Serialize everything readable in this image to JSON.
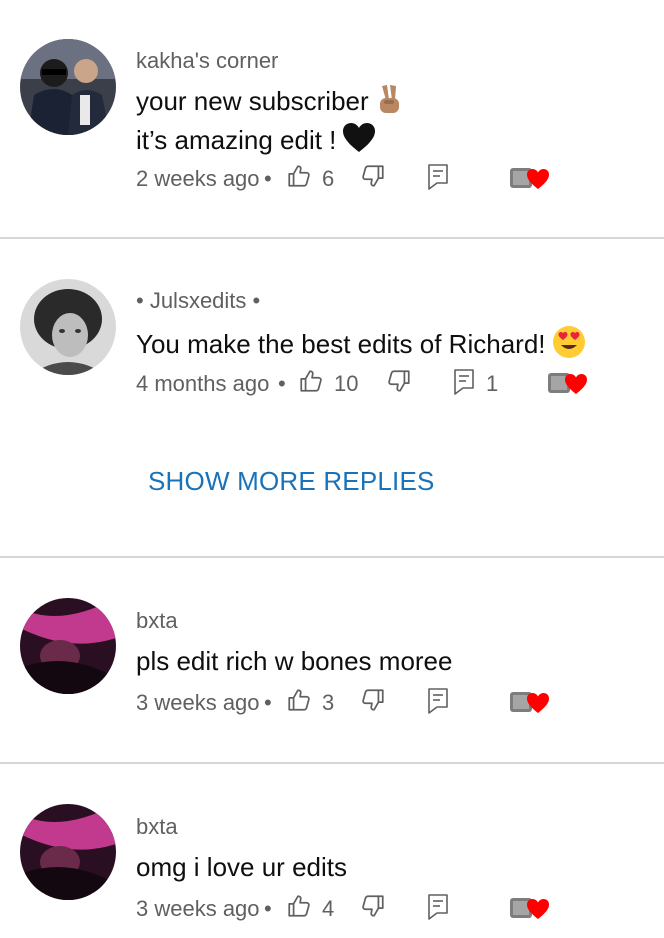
{
  "comments": [
    {
      "author": "kakha's corner",
      "lines": [
        "your new subscriber",
        "it’s amazing edit !"
      ],
      "line_emojis": [
        "victory-hand-emoji",
        "black-heart-emoji"
      ],
      "timestamp": "2 weeks ago",
      "likes": "6",
      "replies": ""
    },
    {
      "author": "• Julsxedits •",
      "lines": [
        "You make the best edits of Richard!"
      ],
      "line_emojis": [
        "heart-eyes-emoji"
      ],
      "timestamp": "4 months ago",
      "likes": "10",
      "replies": "1"
    },
    {
      "author": "bxta",
      "lines": [
        "pls edit rich w bones moree"
      ],
      "timestamp": "3 weeks ago",
      "likes": "3",
      "replies": ""
    },
    {
      "author": "bxta",
      "lines": [
        "omg i love ur edits"
      ],
      "timestamp": "3 weeks ago",
      "likes": "4",
      "replies": ""
    }
  ],
  "show_more_replies": "SHOW MORE REPLIES",
  "separator": "•",
  "icons": {
    "like": "thumbs-up-icon",
    "dislike": "thumbs-down-icon",
    "reply": "reply-icon",
    "creator_heart": "creator-heart-icon"
  },
  "colors": {
    "link": "#1a73b8",
    "secondary_text": "#606060",
    "heart": "#ff0000"
  }
}
